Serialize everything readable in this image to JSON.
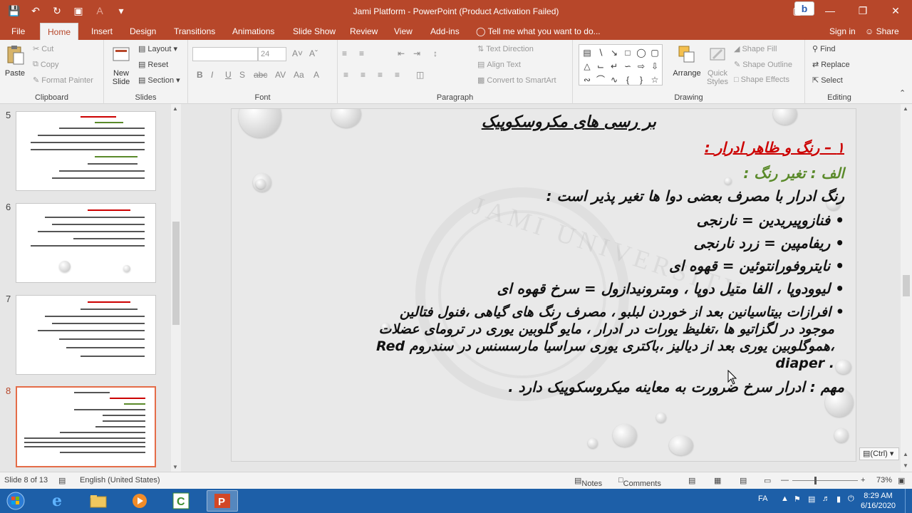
{
  "window": {
    "title": "Jami Platform - PowerPoint (Product Activation Failed)",
    "accent": "#b7472a"
  },
  "tabs": [
    {
      "label": "File"
    },
    {
      "label": "Home"
    },
    {
      "label": "Insert"
    },
    {
      "label": "Design"
    },
    {
      "label": "Transitions"
    },
    {
      "label": "Animations"
    },
    {
      "label": "Slide Show"
    },
    {
      "label": "Review"
    },
    {
      "label": "View"
    },
    {
      "label": "Add-ins"
    }
  ],
  "tell_me": "Tell me what you want to do...",
  "sign_in": "Sign in",
  "share": "Share",
  "ribbon": {
    "clipboard": {
      "paste": "Paste",
      "cut": "Cut",
      "copy": "Copy",
      "format_painter": "Format Painter",
      "label": "Clipboard"
    },
    "slides": {
      "new_slide": "New",
      "new_slide2": "Slide",
      "layout": "Layout",
      "reset": "Reset",
      "section": "Section",
      "label": "Slides"
    },
    "font": {
      "size": "24",
      "label": "Font"
    },
    "paragraph": {
      "text_direction": "Text Direction",
      "align_text": "Align Text",
      "convert_smartart": "Convert to SmartArt",
      "label": "Paragraph"
    },
    "drawing": {
      "arrange": "Arrange",
      "quick_styles": "Quick",
      "quick_styles2": "Styles",
      "shape_fill": "Shape Fill",
      "shape_outline": "Shape Outline",
      "shape_effects": "Shape Effects",
      "label": "Drawing"
    },
    "editing": {
      "find": "Find",
      "replace": "Replace",
      "select": "Select",
      "label": "Editing"
    }
  },
  "thumbnails": [
    {
      "number": "5",
      "selected": false
    },
    {
      "number": "6",
      "selected": false
    },
    {
      "number": "7",
      "selected": false
    },
    {
      "number": "8",
      "selected": true
    }
  ],
  "slide": {
    "title": "بر رسی های مکروسکوپیک",
    "heading": "۱ – رنگ و ظاهر ادرار :",
    "subheading": "الف : تغیر رنگ :",
    "intro": "رنگ ادرار با مصرف بعضی دوا ها تغیر پذیر است :",
    "bullets": [
      "فنازوپیریدین = نارنجی",
      "ریفامپین = زرد نارنجی",
      "نایتروفورانتوئین = قهوه ای",
      "لیوودوپا ، الفا متیل دوپا ، ومترونیدازول = سرخ قهوه ای"
    ],
    "long_bullet": [
      "افرازات بیتاسیانین بعد از خوردن لبلبو ، مصرف رنگ های گیاهی ،فنول فتالین",
      "موجود در لگزاتیو ها ،تغلیظ یورات در ادرار ، مایو گلوبین یوری در ترومای عضلات",
      "،هموگلوبین یوری بعد از دیالیز ،باکتری یوری سراسیا مارسسنس در سندروم Red",
      "diaper ."
    ],
    "note": "مهم : ادرار سرخ ضرورت به معاینه میکروسکوپیک دارد .",
    "watermark": "JAMI UNIVERSITY",
    "colors": {
      "heading": "#cc0000",
      "subheading": "#5a8a2a",
      "text": "#111111"
    }
  },
  "paste_options": "(Ctrl)",
  "status": {
    "slide_counter": "Slide 8 of 13",
    "language": "English (United States)",
    "notes": "Notes",
    "comments": "Comments",
    "zoom": "73%"
  },
  "taskbar": {
    "time": "8:29 AM",
    "date": "6/16/2020",
    "lang": "FA"
  }
}
